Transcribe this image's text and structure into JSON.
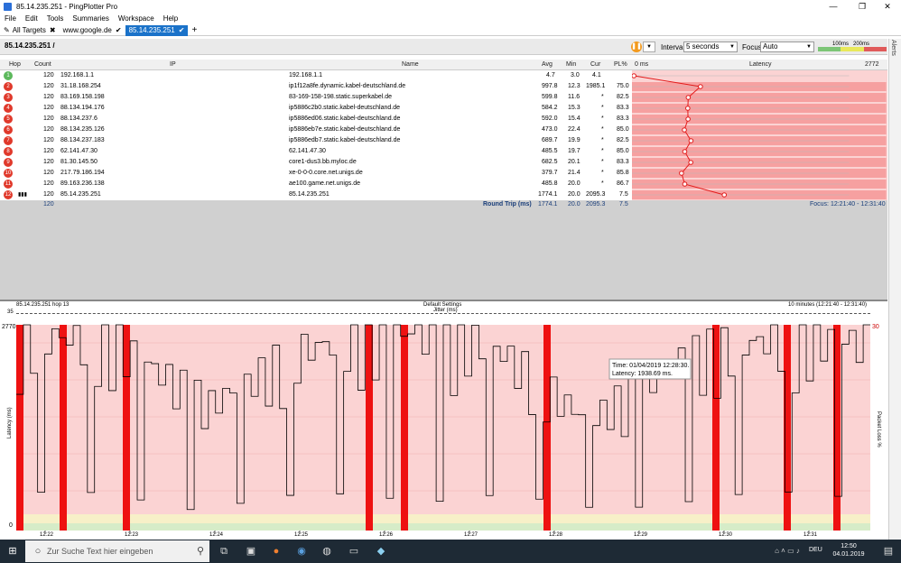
{
  "window": {
    "title": "85.14.235.251 - PingPlotter Pro",
    "min": "—",
    "max": "❐",
    "close": "✕"
  },
  "menu": [
    "File",
    "Edit",
    "Tools",
    "Summaries",
    "Workspace",
    "Help"
  ],
  "tabs": [
    {
      "label": "All Targets",
      "mark": "✖"
    },
    {
      "label": "www.google.de",
      "mark": "✔"
    },
    {
      "label": "85.14.235.251",
      "mark": "✔"
    },
    {
      "label": "+",
      "mark": ""
    }
  ],
  "toolbar": {
    "breadcrumb": "85.14.235.251 /",
    "interval_label": "Interval",
    "interval_value": "5 seconds",
    "focus_label": "Focus",
    "focus_value": "Auto",
    "legend_100": "100ms",
    "legend_200": "200ms",
    "alerts": "Alerts"
  },
  "columns": {
    "hop": "Hop",
    "count": "Count",
    "ip": "IP",
    "name": "Name",
    "avg": "Avg",
    "min": "Min",
    "cur": "Cur",
    "pl": "PL%",
    "zero": "0 ms",
    "latency": "Latency",
    "max": "2772 ms"
  },
  "hops": [
    {
      "hop": "1",
      "count": "120",
      "ip": "192.168.1.1",
      "name": "192.168.1.1",
      "avg": "4.7",
      "min": "3.0",
      "cur": "4.1",
      "pl": "",
      "color": "#5cb85c"
    },
    {
      "hop": "2",
      "count": "120",
      "ip": "31.18.168.254",
      "name": "ip1f12a8fe.dynamic.kabel-deutschland.de",
      "avg": "997.8",
      "min": "12.3",
      "cur": "1985.1",
      "pl": "75.0",
      "color": "#e0392b"
    },
    {
      "hop": "3",
      "count": "120",
      "ip": "83.169.158.198",
      "name": "83-169-158-198.static.superkabel.de",
      "avg": "599.8",
      "min": "11.6",
      "cur": "*",
      "pl": "82.5",
      "color": "#e0392b"
    },
    {
      "hop": "4",
      "count": "120",
      "ip": "88.134.194.176",
      "name": "ip5886c2b0.static.kabel-deutschland.de",
      "avg": "584.2",
      "min": "15.3",
      "cur": "*",
      "pl": "83.3",
      "color": "#e0392b"
    },
    {
      "hop": "5",
      "count": "120",
      "ip": "88.134.237.6",
      "name": "ip5886ed06.static.kabel-deutschland.de",
      "avg": "592.0",
      "min": "15.4",
      "cur": "*",
      "pl": "83.3",
      "color": "#e0392b"
    },
    {
      "hop": "6",
      "count": "120",
      "ip": "88.134.235.126",
      "name": "ip5886eb7e.static.kabel-deutschland.de",
      "avg": "473.0",
      "min": "22.4",
      "cur": "*",
      "pl": "85.0",
      "color": "#e0392b"
    },
    {
      "hop": "7",
      "count": "120",
      "ip": "88.134.237.183",
      "name": "ip5886edb7.static.kabel-deutschland.de",
      "avg": "689.7",
      "min": "19.9",
      "cur": "*",
      "pl": "82.5",
      "color": "#e0392b"
    },
    {
      "hop": "8",
      "count": "120",
      "ip": "62.141.47.30",
      "name": "62.141.47.30",
      "avg": "485.5",
      "min": "19.7",
      "cur": "*",
      "pl": "85.0",
      "color": "#e0392b"
    },
    {
      "hop": "9",
      "count": "120",
      "ip": "81.30.145.50",
      "name": "core1-dus3.bb.myloc.de",
      "avg": "682.5",
      "min": "20.1",
      "cur": "*",
      "pl": "83.3",
      "color": "#e0392b"
    },
    {
      "hop": "10",
      "count": "120",
      "ip": "217.79.186.194",
      "name": "xe-0-0-0.core.net.unigs.de",
      "avg": "379.7",
      "min": "21.4",
      "cur": "*",
      "pl": "85.8",
      "color": "#e0392b"
    },
    {
      "hop": "11",
      "count": "120",
      "ip": "89.163.236.138",
      "name": "ae100.game.net.unigs.de",
      "avg": "485.8",
      "min": "20.0",
      "cur": "*",
      "pl": "86.7",
      "color": "#e0392b"
    },
    {
      "hop": "12",
      "count": "120",
      "ip": "85.14.235.251",
      "name": "85.14.235.251",
      "avg": "1774.1",
      "min": "20.0",
      "cur": "2095.3",
      "pl": "7.5",
      "color": "#e0392b"
    }
  ],
  "summary": {
    "count": "120",
    "label": "Round Trip (ms)",
    "avg": "1774.1",
    "min": "20.0",
    "cur": "2095.3",
    "pl": "7.5",
    "focus": "Focus: 12:21:40 - 12:31:40"
  },
  "graph": {
    "target": "85.14.235.251 hop 13",
    "settings": "Default Settings",
    "range": "10 minutes (12:21:40 - 12:31:40)",
    "jitter_label": "Jitter (ms)",
    "jitter_max": "35",
    "y_max": "2770",
    "y_min": "0",
    "pl_max": "30",
    "ylabel": "Latency (ms)",
    "y2label": "Packet Loss %",
    "times": [
      "12:22",
      "12:23",
      "12:24",
      "12:25",
      "12:26",
      "12:27",
      "12:28",
      "12:29",
      "12:30",
      "12:31"
    ],
    "tooltip_time": "Time: 01/04/2019 12:28:30.",
    "tooltip_latency": "Latency: 1938.69 ms."
  },
  "chart_data": {
    "type": "line",
    "xlabel": "",
    "ylabel": "Latency (ms)",
    "ylim": [
      0,
      2770
    ],
    "x": [
      "12:22",
      "12:23",
      "12:24",
      "12:25",
      "12:26",
      "12:27",
      "12:28",
      "12:29",
      "12:30",
      "12:31"
    ],
    "series": [
      {
        "values": [
          2400,
          2300,
          1500,
          2200,
          2450,
          2250,
          1300,
          2100,
          2350,
          2300
        ]
      }
    ]
  },
  "taskbar": {
    "search": "Zur Suche Text hier eingeben",
    "lang": "DEU",
    "time": "12:50",
    "date": "04.01.2019"
  }
}
